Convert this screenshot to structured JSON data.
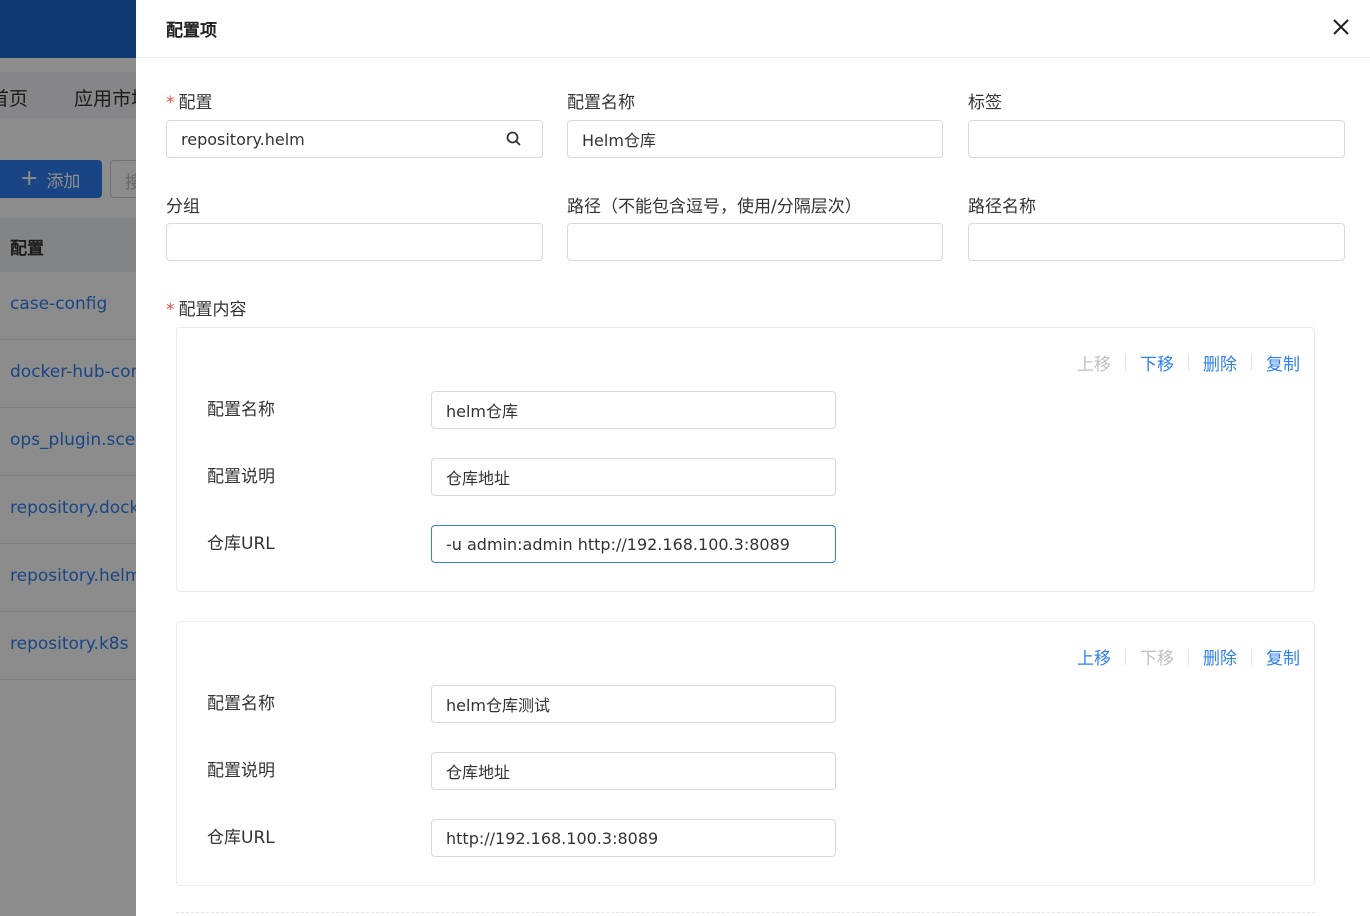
{
  "background": {
    "nav": [
      "首页",
      "应用市场"
    ],
    "add_button": "添加",
    "add_icon": "plus-icon",
    "search_placeholder": "搜索",
    "table_header": "配置",
    "rows": [
      "case-config",
      "docker-hub-config",
      "ops_plugin.scene",
      "repository.docker",
      "repository.helm",
      "repository.k8s"
    ]
  },
  "drawer": {
    "title": "配置项",
    "close_icon": "close-icon",
    "fields": {
      "config": {
        "label": "配置",
        "required": "*",
        "value": "repository.helm",
        "search_icon": "search-icon"
      },
      "config_name": {
        "label": "配置名称",
        "value": "Helm仓库"
      },
      "tags": {
        "label": "标签",
        "value": ""
      },
      "group": {
        "label": "分组",
        "value": ""
      },
      "path": {
        "label": "路径（不能包含逗号，使用/分隔层次）",
        "value": ""
      },
      "path_name": {
        "label": "路径名称",
        "value": ""
      },
      "content": {
        "label": "配置内容",
        "required": "*"
      }
    },
    "actions": {
      "up": "上移",
      "down": "下移",
      "delete": "删除",
      "copy": "复制"
    },
    "items": [
      {
        "name_label": "配置名称",
        "name_value": "helm仓库",
        "desc_label": "配置说明",
        "desc_value": "仓库地址",
        "url_label": "仓库URL",
        "url_value": "-u admin:admin http://192.168.100.3:8089"
      },
      {
        "name_label": "配置名称",
        "name_value": "helm仓库测试",
        "desc_label": "配置说明",
        "desc_value": "仓库地址",
        "url_label": "仓库URL",
        "url_value": "http://192.168.100.3:8089"
      }
    ]
  },
  "colors": {
    "primary": "#2f7ff0",
    "required": "#e34d4d",
    "disabled": "#bfbfbf"
  }
}
